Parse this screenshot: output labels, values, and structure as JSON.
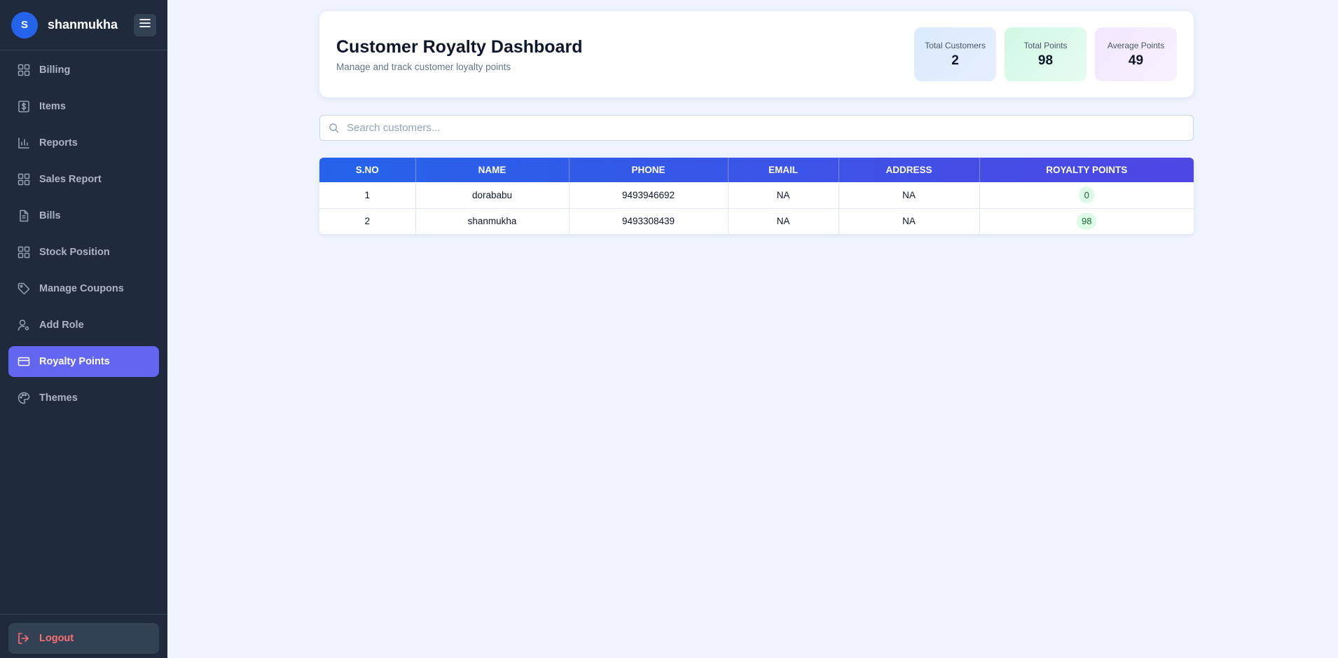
{
  "sidebar": {
    "avatar_initial": "S",
    "brand": "shanmukha",
    "items": [
      {
        "label": "Billing",
        "icon": "grid-icon"
      },
      {
        "label": "Items",
        "icon": "dollar-icon"
      },
      {
        "label": "Reports",
        "icon": "bar-chart-icon"
      },
      {
        "label": "Sales Report",
        "icon": "grid-icon"
      },
      {
        "label": "Bills",
        "icon": "file-icon"
      },
      {
        "label": "Stock Position",
        "icon": "grid-icon"
      },
      {
        "label": "Manage Coupons",
        "icon": "tag-icon"
      },
      {
        "label": "Add Role",
        "icon": "user-gear-icon"
      },
      {
        "label": "Royalty Points",
        "icon": "credit-card-icon",
        "active": true
      },
      {
        "label": "Themes",
        "icon": "palette-icon"
      }
    ],
    "logout_label": "Logout"
  },
  "header": {
    "title": "Customer Royalty Dashboard",
    "subtitle": "Manage and track customer loyalty points",
    "stats": [
      {
        "label": "Total Customers",
        "value": "2"
      },
      {
        "label": "Total Points",
        "value": "98"
      },
      {
        "label": "Average Points",
        "value": "49"
      }
    ]
  },
  "search": {
    "placeholder": "Search customers...",
    "value": ""
  },
  "table": {
    "columns": [
      "S.NO",
      "NAME",
      "PHONE",
      "EMAIL",
      "ADDRESS",
      "ROYALTY POINTS"
    ],
    "rows": [
      {
        "sno": "1",
        "name": "dorababu",
        "phone": "9493946692",
        "email": "NA",
        "address": "NA",
        "points": "0"
      },
      {
        "sno": "2",
        "name": "shanmukha",
        "phone": "9493308439",
        "email": "NA",
        "address": "NA",
        "points": "98"
      }
    ]
  },
  "colors": {
    "sidebar_bg": "#1f2a3c",
    "active_item": "#6366f1",
    "header_gradient_start": "#2563eb",
    "header_gradient_end": "#4f46e5",
    "logout_text": "#f87171"
  }
}
